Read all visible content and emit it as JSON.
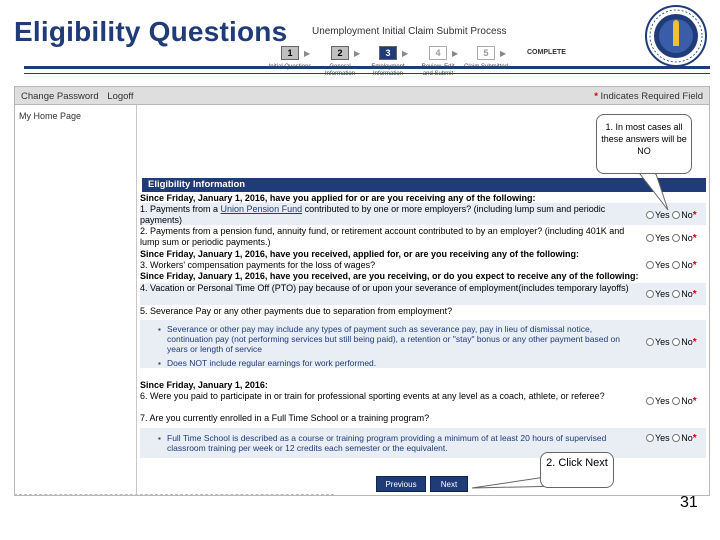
{
  "slide": {
    "title": "Eligibility Questions",
    "page_number": "31",
    "colors": {
      "accent": "#1f3b78",
      "required": "#cc0000"
    },
    "seal_icon": "massachusetts-seal-icon"
  },
  "topbar": {
    "change_password": "Change Password",
    "logoff": "Logoff",
    "required_star": "*",
    "required_note": "Indicates Required Field"
  },
  "sidebar": {
    "home": "My Home Page"
  },
  "process": {
    "title": "Unemployment Initial Claim Submit Process",
    "steps": [
      {
        "num": "1",
        "label": "Initial Questions"
      },
      {
        "num": "2",
        "label": "General Information"
      },
      {
        "num": "3",
        "label": "Employment Information"
      },
      {
        "num": "4",
        "label": "Review, Edit and Submit"
      },
      {
        "num": "5",
        "label": "Claim Submitted"
      }
    ],
    "complete": "COMPLETE"
  },
  "callouts": {
    "one": "1. In most cases all these answers will be NO",
    "two": "2. Click Next"
  },
  "section": {
    "header": "Eligibility Information",
    "h1": "Since Friday, January 1, 2016, have you applied for or are you receiving any of the following:",
    "q1_prefix": "1. Payments from a ",
    "q1_link": "Union Pension Fund",
    "q1_suffix": " contributed to by one or more employers? (including lump sum and periodic payments)",
    "q2": "2. Payments from a pension fund, annuity fund, or retirement account contributed to by an employer? (including 401K and lump sum or periodic payments.)",
    "h2": "Since Friday, January 1, 2016, have you received, applied for, or are you receiving any of the following:",
    "q3": "3. Workers' compensation payments for the loss of wages?",
    "h3": "Since Friday, January 1, 2016, have you received, are you receiving, or do you expect to receive any of the following:",
    "q4": "4. Vacation or Personal Time Off (PTO) pay because of or upon your severance of employment(includes temporary layoffs)",
    "q5": "5. Severance Pay or any other payments due to separation from employment?",
    "b5a": "Severance or other pay may include any types of payment such as severance pay, pay in lieu of dismissal notice, continuation pay (not performing services but still being paid), a retention or \"stay\" bonus or any other payment based on years or length of service",
    "b5b": "Does NOT include regular earnings for work performed.",
    "h4": "Since Friday, January 1, 2016:",
    "q6": "6. Were you paid to participate in or train for professional sporting events at any level as a coach, athlete, or referee?",
    "q7": "7. Are you currently enrolled in a Full Time School or a training program?",
    "b7": "Full Time School is described as a course or training program providing a minimum of at least 20 hours of supervised classroom training per week or 12 credits each semester or the equivalent.",
    "yes": "Yes",
    "no": "No",
    "star": "*"
  },
  "buttons": {
    "previous": "Previous",
    "next": "Next"
  }
}
